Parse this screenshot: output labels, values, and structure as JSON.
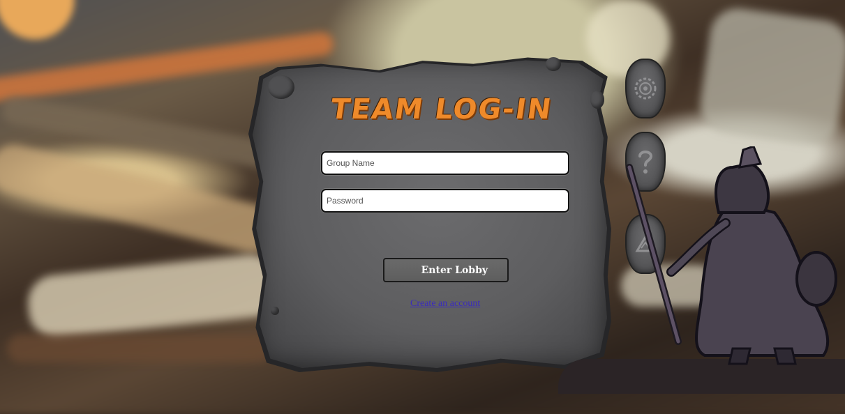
{
  "header": {
    "title": "TEAM LOG-IN"
  },
  "form": {
    "group_name_placeholder": "Group Name",
    "group_name_value": "",
    "password_placeholder": "Password",
    "password_value": "",
    "submit_label": "Enter Lobby",
    "create_account_label": "Create an account"
  },
  "side_buttons": [
    {
      "icon": "gear-icon"
    },
    {
      "icon": "help-icon",
      "glyph": "?"
    },
    {
      "icon": "triangle-icon"
    }
  ],
  "colors": {
    "title": "#ef8a2a",
    "panel": "#5d5d5f",
    "link": "#3a2bbf",
    "button": "#5e5e5e"
  }
}
